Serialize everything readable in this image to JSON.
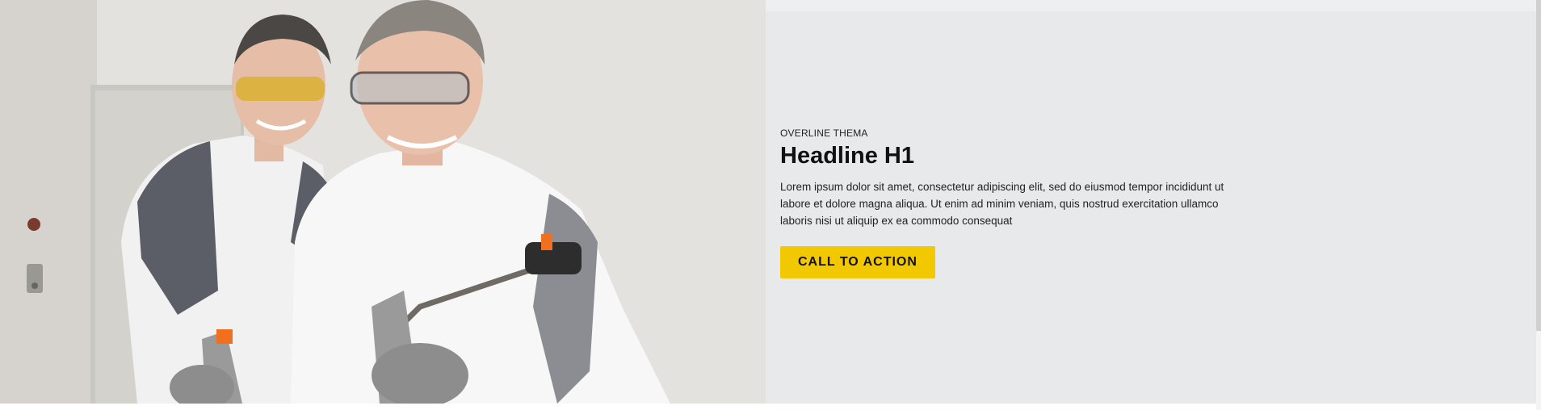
{
  "hero": {
    "image_alt": "two painters with spray guns",
    "overline": "OVERLINE THEMA",
    "headline": "Headline H1",
    "body": "Lorem ipsum dolor sit amet, consectetur adipiscing elit, sed do eiusmod tempor incididunt ut labore et dolore magna aliqua. Ut enim ad minim veniam, quis nostrud exercitation ullamco laboris nisi ut aliquip ex ea commodo consequat",
    "cta_label": "CALL TO ACTION"
  },
  "colors": {
    "accent": "#f2c900",
    "panel_background": "#e8e9ea",
    "text": "#111111"
  }
}
